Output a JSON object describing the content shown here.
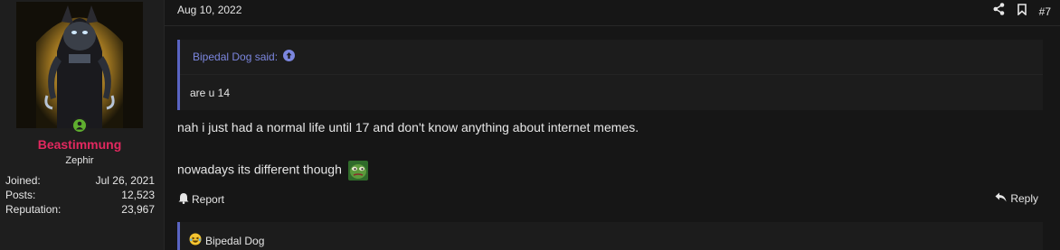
{
  "user": {
    "name": "Beastimmung",
    "title": "Zephir",
    "name_color": "#e2285f",
    "online_color": "#5fae2f",
    "stats": [
      {
        "label": "Joined:",
        "value": "Jul 26, 2021"
      },
      {
        "label": "Posts:",
        "value": "12,523"
      },
      {
        "label": "Reputation:",
        "value": "23,967"
      }
    ]
  },
  "post": {
    "date": "Aug 10, 2022",
    "number": "#7",
    "quote": {
      "author_line": "Bipedal Dog said:",
      "text": "are u 14"
    },
    "lines": [
      "nah i just had a normal life until 17 and don't know anything about internet memes.",
      "nowadays its different though"
    ],
    "icons": {
      "share": "share-icon",
      "bookmark": "bookmark-icon",
      "emote": "pepe-emote-icon",
      "report": "bell-icon",
      "reply": "reply-arrow-icon",
      "reaction": "laughing-emoji-icon"
    },
    "report_label": "Report",
    "reply_label": "Reply",
    "reaction_user": "Bipedal Dog"
  }
}
